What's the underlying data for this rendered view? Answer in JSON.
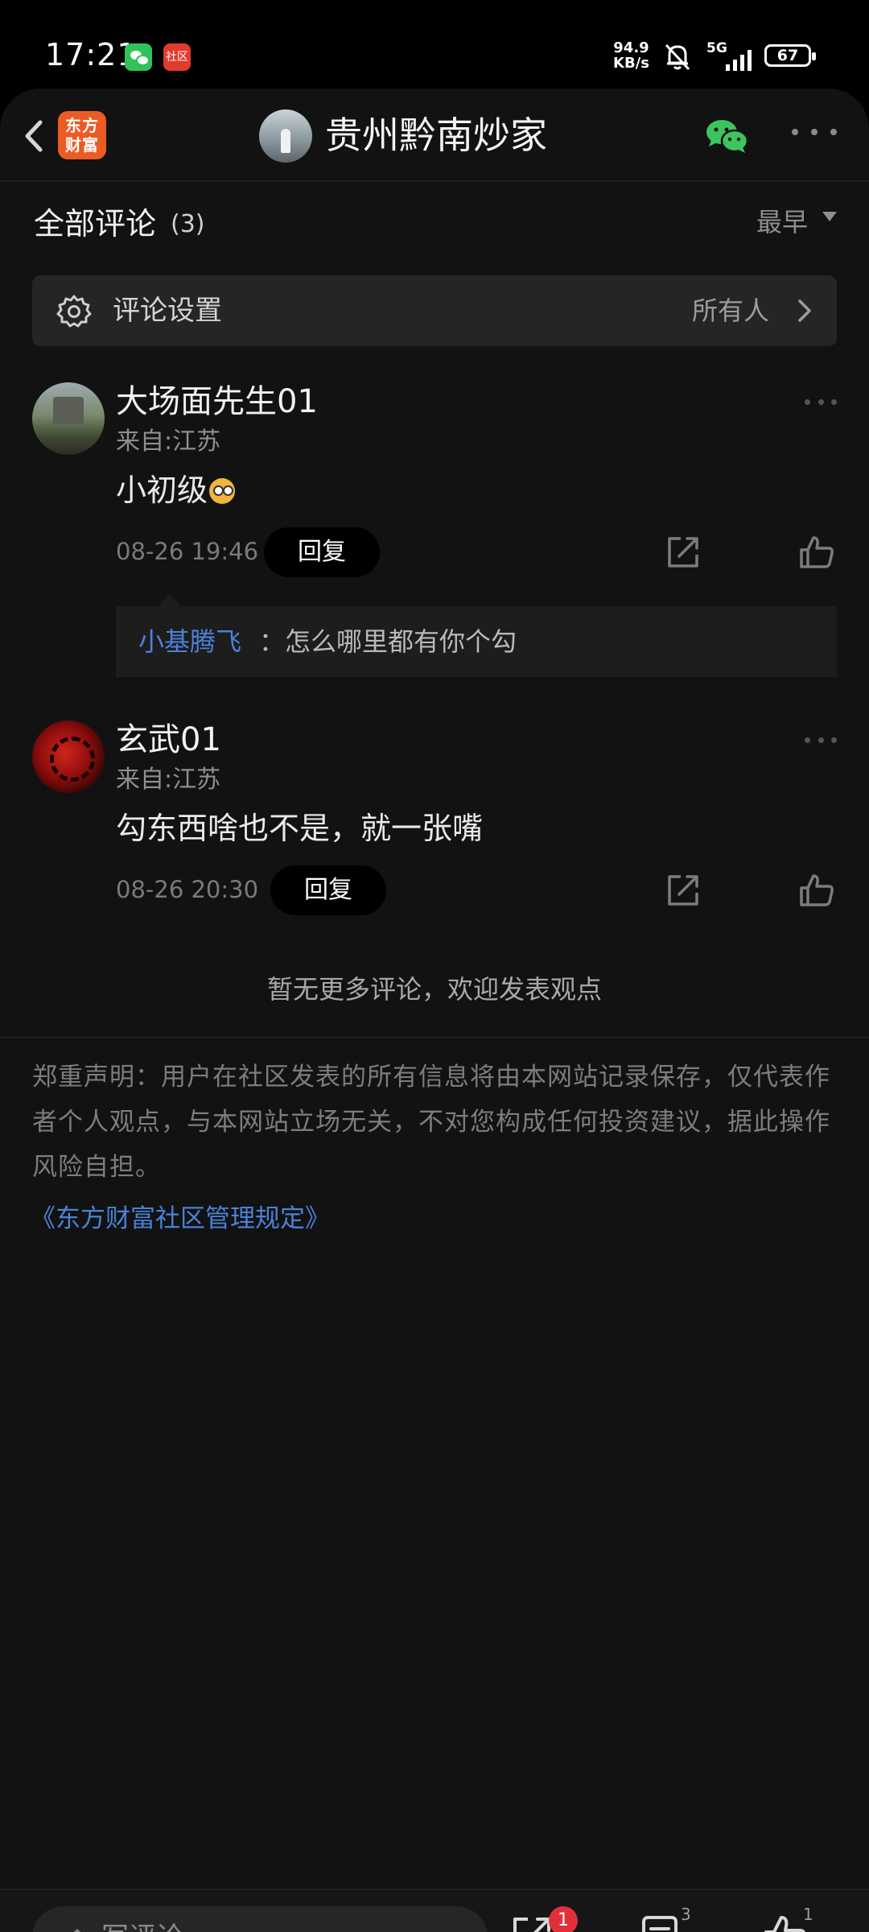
{
  "status_bar": {
    "time": "17:21",
    "community_icon_text": "社区",
    "net_speed_value": "94.9",
    "net_speed_unit": "KB/s",
    "network": "5G",
    "battery_level": "67"
  },
  "header": {
    "app_logo_text_1": "东方",
    "app_logo_text_2": "财富",
    "title": "贵州黔南炒家"
  },
  "comments_section": {
    "title": "全部评论",
    "count": "(3)",
    "sort_label": "最早"
  },
  "settings": {
    "label": "评论设置",
    "value": "所有人"
  },
  "comments": [
    {
      "user": "大场面先生01",
      "from": "来自:江苏",
      "text": "小初级",
      "time": "08-26 19:46",
      "reply_label": "回复",
      "sub_reply": {
        "user": "小基腾飞",
        "text": "：怎么哪里都有你个勾"
      }
    },
    {
      "user": "玄武01",
      "from": "来自:江苏",
      "text": "勾东西啥也不是，就一张嘴",
      "time": "08-26 20:30",
      "reply_label": "回复"
    }
  ],
  "no_more_text": "暂无更多评论，欢迎发表观点",
  "disclaimer": "郑重声明：用户在社区发表的所有信息将由本网站记录保存，仅代表作者个人观点，与本网站立场无关，不对您构成任何投资建议，据此操作风险自担。",
  "rules_link": "《东方财富社区管理规定》",
  "bottom_bar": {
    "comment_placeholder": "写评论...",
    "share_badge": "1",
    "comment_count": "3",
    "like_count": "1"
  },
  "colors": {
    "background": "#121212",
    "accent_link": "#4a82d8",
    "brand_orange": "#ec5b24",
    "badge_red": "#e2303a",
    "wechat_green": "#2fc35a"
  },
  "icons": [
    "back-icon",
    "wechat-icon",
    "more-icon",
    "gear-icon",
    "chevron-right-icon",
    "share-icon",
    "like-icon",
    "pencil-icon",
    "comment-list-icon",
    "bell-off-icon",
    "signal-icon",
    "battery-icon"
  ]
}
